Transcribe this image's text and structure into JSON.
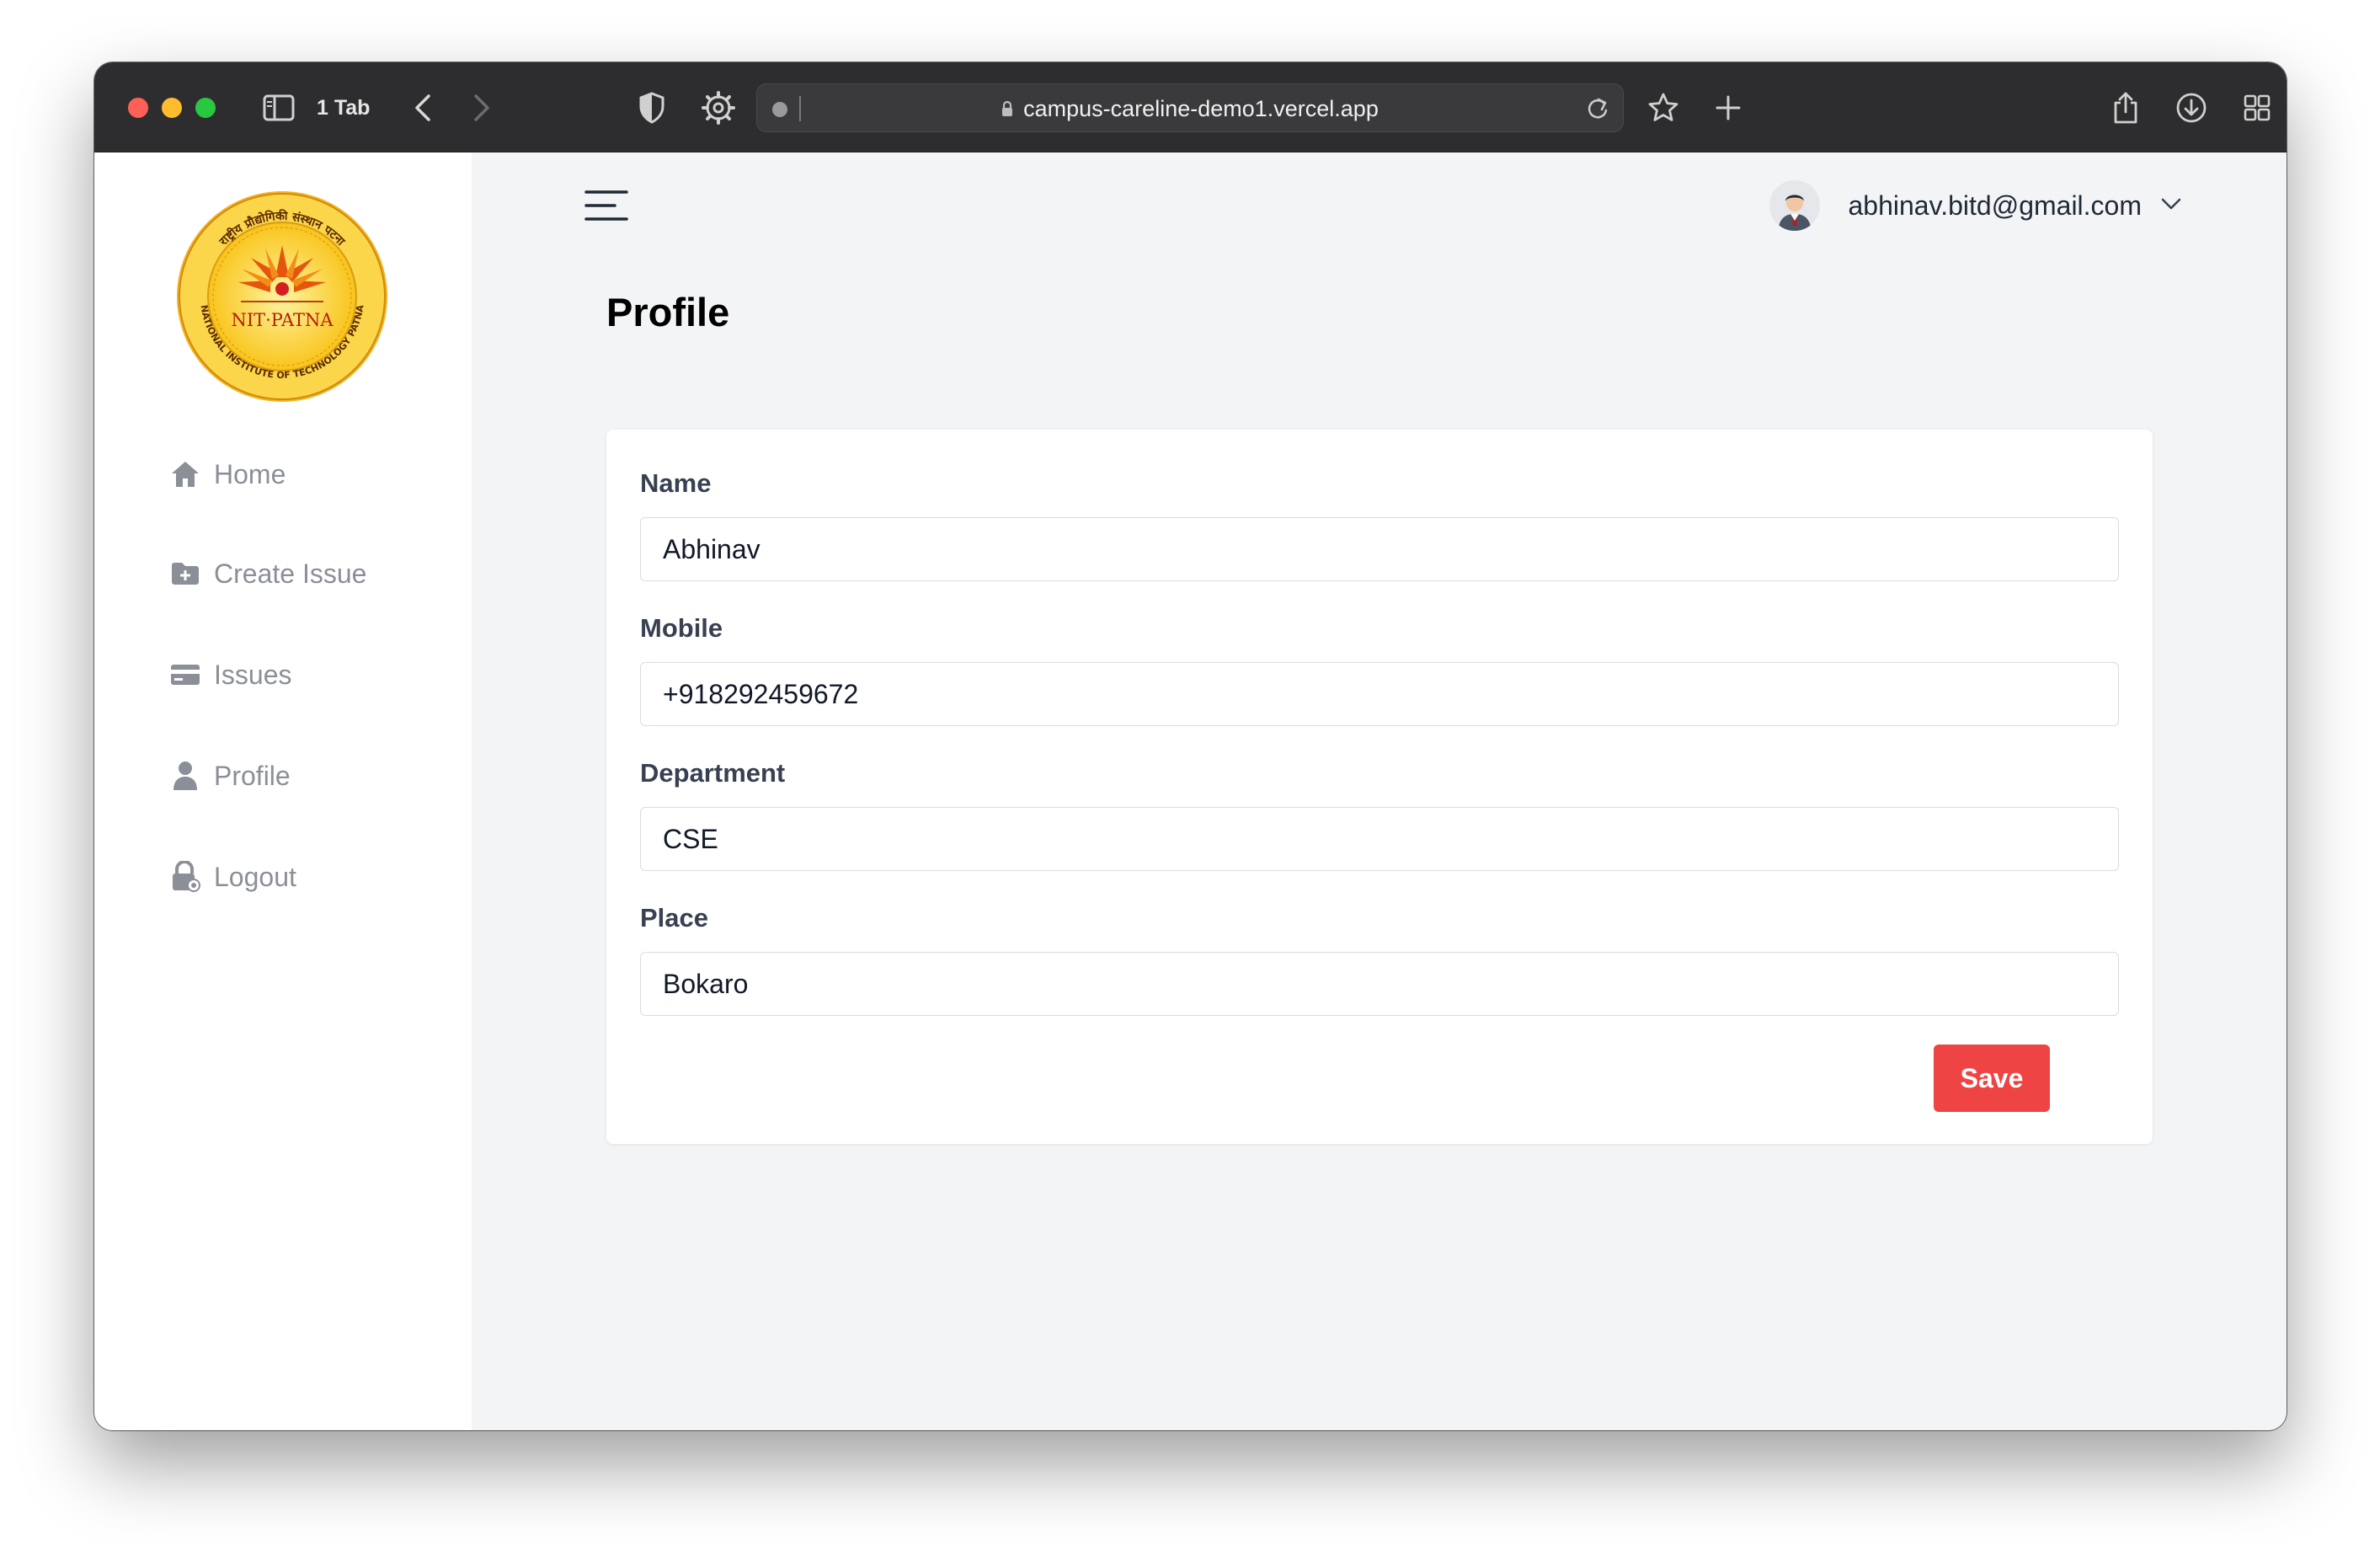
{
  "browser": {
    "tab_count_label": "1 Tab",
    "url": "campus-careline-demo1.vercel.app"
  },
  "sidebar": {
    "logo": {
      "name": "nit-patna-logo",
      "top_text": "राष्ट्रीय प्रौद्योगिकी संस्थान पटना",
      "center_text": "NIT·PATNA",
      "bottom_text": "NATIONAL INSTITUTE OF TECHNOLOGY PATNA"
    },
    "items": [
      {
        "label": "Home",
        "icon": "home-icon"
      },
      {
        "label": "Create Issue",
        "icon": "folder-plus-icon"
      },
      {
        "label": "Issues",
        "icon": "credit-card-icon"
      },
      {
        "label": "Profile",
        "icon": "user-icon"
      },
      {
        "label": "Logout",
        "icon": "lock-icon"
      }
    ]
  },
  "header": {
    "user_email": "abhinav.bitd@gmail.com"
  },
  "page": {
    "title": "Profile",
    "fields": [
      {
        "label": "Name",
        "value": "Abhinav"
      },
      {
        "label": "Mobile",
        "value": "+918292459672"
      },
      {
        "label": "Department",
        "value": "CSE"
      },
      {
        "label": "Place",
        "value": "Bokaro"
      }
    ],
    "save_label": "Save"
  },
  "colors": {
    "accent": "#ef4444",
    "sidebar_bg": "#ffffff",
    "main_bg": "#f3f4f6",
    "nav_text": "#8b8f97"
  }
}
